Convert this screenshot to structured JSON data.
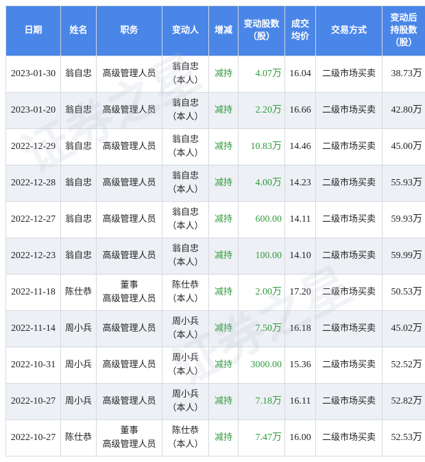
{
  "headers": {
    "date": "日期",
    "name": "姓名",
    "position": "职务",
    "changer": "变动人",
    "direction": "增减",
    "shares_line1": "变动股数",
    "shares_line2": "（股）",
    "price_line1": "成交",
    "price_line2": "均价",
    "method": "交易方式",
    "hold_line1": "变动后",
    "hold_line2": "持股数",
    "hold_line3": "（股）"
  },
  "watermark": "证券之星",
  "rows": [
    {
      "date": "2023-01-30",
      "name": "翁自忠",
      "position_line1": "",
      "position_line2": "高级管理人员",
      "changer_line1": "翁自忠",
      "changer_line2": "（本人）",
      "direction": "减持",
      "shares": "4.07万",
      "price": "16.04",
      "method": "二级市场买卖",
      "hold": "38.73万"
    },
    {
      "date": "2023-01-20",
      "name": "翁自忠",
      "position_line1": "",
      "position_line2": "高级管理人员",
      "changer_line1": "翁自忠",
      "changer_line2": "（本人）",
      "direction": "减持",
      "shares": "2.20万",
      "price": "16.66",
      "method": "二级市场买卖",
      "hold": "42.80万"
    },
    {
      "date": "2022-12-29",
      "name": "翁自忠",
      "position_line1": "",
      "position_line2": "高级管理人员",
      "changer_line1": "翁自忠",
      "changer_line2": "（本人）",
      "direction": "减持",
      "shares": "10.83万",
      "price": "14.46",
      "method": "二级市场买卖",
      "hold": "45.00万"
    },
    {
      "date": "2022-12-28",
      "name": "翁自忠",
      "position_line1": "",
      "position_line2": "高级管理人员",
      "changer_line1": "翁自忠",
      "changer_line2": "（本人）",
      "direction": "减持",
      "shares": "4.00万",
      "price": "14.23",
      "method": "二级市场买卖",
      "hold": "55.93万"
    },
    {
      "date": "2022-12-27",
      "name": "翁自忠",
      "position_line1": "",
      "position_line2": "高级管理人员",
      "changer_line1": "翁自忠",
      "changer_line2": "（本人）",
      "direction": "减持",
      "shares": "600.00",
      "price": "14.11",
      "method": "二级市场买卖",
      "hold": "59.93万"
    },
    {
      "date": "2022-12-23",
      "name": "翁自忠",
      "position_line1": "",
      "position_line2": "高级管理人员",
      "changer_line1": "翁自忠",
      "changer_line2": "（本人）",
      "direction": "减持",
      "shares": "100.00",
      "price": "14.10",
      "method": "二级市场买卖",
      "hold": "59.99万"
    },
    {
      "date": "2022-11-18",
      "name": "陈仕恭",
      "position_line1": "董事",
      "position_line2": "高级管理人员",
      "changer_line1": "陈仕恭",
      "changer_line2": "（本人）",
      "direction": "减持",
      "shares": "2.00万",
      "price": "17.20",
      "method": "二级市场买卖",
      "hold": "50.53万"
    },
    {
      "date": "2022-11-14",
      "name": "周小兵",
      "position_line1": "",
      "position_line2": "高级管理人员",
      "changer_line1": "周小兵",
      "changer_line2": "（本人）",
      "direction": "减持",
      "shares": "7.50万",
      "price": "16.18",
      "method": "二级市场买卖",
      "hold": "45.02万"
    },
    {
      "date": "2022-10-31",
      "name": "周小兵",
      "position_line1": "",
      "position_line2": "高级管理人员",
      "changer_line1": "周小兵",
      "changer_line2": "（本人）",
      "direction": "减持",
      "shares": "3000.00",
      "price": "15.36",
      "method": "二级市场买卖",
      "hold": "52.52万"
    },
    {
      "date": "2022-10-27",
      "name": "周小兵",
      "position_line1": "",
      "position_line2": "高级管理人员",
      "changer_line1": "周小兵",
      "changer_line2": "（本人）",
      "direction": "减持",
      "shares": "7.18万",
      "price": "16.11",
      "method": "二级市场买卖",
      "hold": "52.82万"
    },
    {
      "date": "2022-10-27",
      "name": "陈仕恭",
      "position_line1": "董事",
      "position_line2": "高级管理人员",
      "changer_line1": "陈仕恭",
      "changer_line2": "（本人）",
      "direction": "减持",
      "shares": "7.47万",
      "price": "16.00",
      "method": "二级市场买卖",
      "hold": "52.53万"
    }
  ]
}
